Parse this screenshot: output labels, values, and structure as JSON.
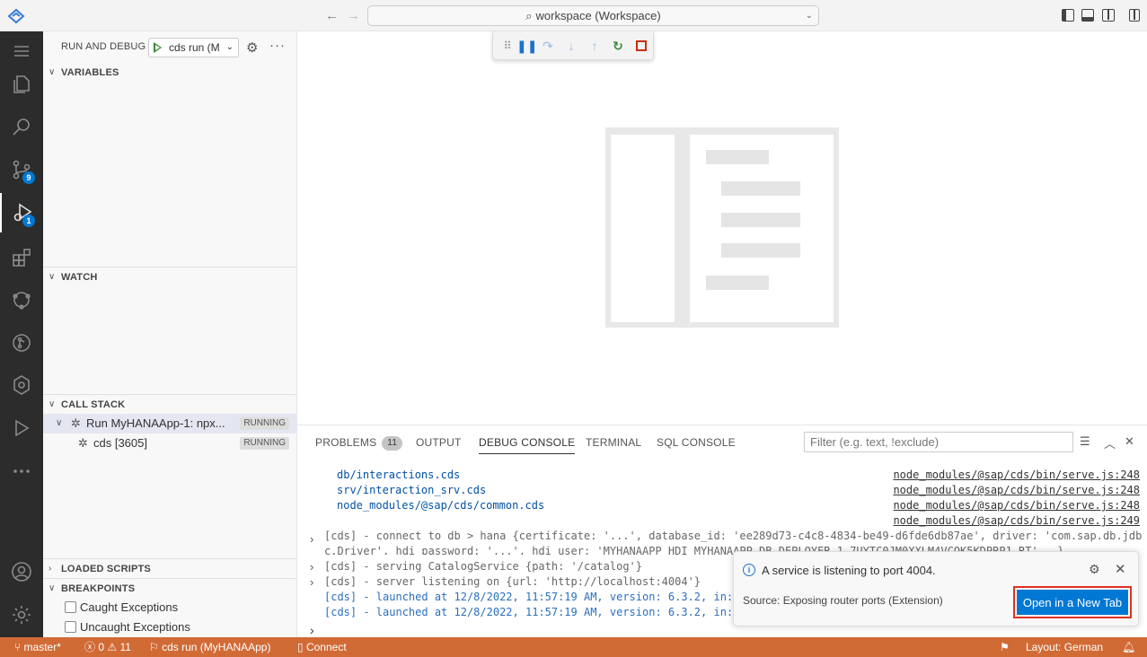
{
  "titlebar": {
    "command_center": "workspace (Workspace)"
  },
  "activity_bar": {
    "source_control_badge": "9",
    "debug_badge": "1"
  },
  "sidebar": {
    "title": "RUN AND DEBUG",
    "config": "cds run (M",
    "sections": {
      "variables": "VARIABLES",
      "watch": "WATCH",
      "call_stack": "CALL STACK",
      "loaded_scripts": "LOADED SCRIPTS",
      "breakpoints": "BREAKPOINTS"
    },
    "call_stack": [
      {
        "label": "Run MyHANAApp-1: npx...",
        "state": "RUNNING"
      },
      {
        "label": "cds [3605]",
        "state": "RUNNING"
      }
    ],
    "breakpoints": [
      {
        "label": "Caught Exceptions",
        "checked": false
      },
      {
        "label": "Uncaught Exceptions",
        "checked": false
      }
    ]
  },
  "panel": {
    "tabs": {
      "problems": "PROBLEMS",
      "problems_count": "11",
      "output": "OUTPUT",
      "debug_console": "DEBUG CONSOLE",
      "terminal": "TERMINAL",
      "sql_console": "SQL CONSOLE"
    },
    "filter_placeholder": "Filter (e.g. text, !exclude)",
    "console": {
      "files": [
        {
          "text": "db/interactions.cds",
          "src": "node_modules/@sap/cds/bin/serve.js:248"
        },
        {
          "text": "srv/interaction_srv.cds",
          "src": "node_modules/@sap/cds/bin/serve.js:248"
        },
        {
          "text": "node_modules/@sap/cds/common.cds",
          "src": "node_modules/@sap/cds/bin/serve.js:248"
        },
        {
          "text": "",
          "src": "node_modules/@sap/cds/bin/serve.js:249"
        }
      ],
      "connect_1": "[cds] - connect to db > hana {certificate: '...', database_id: 'ee289d73-c4c8-4834-be49-d6fde6db87ae', driver: 'com.sap.db.jdb",
      "connect_2": "c.Driver', hdi_password: '...', hdi_user: 'MYHANAAPP_HDI_MYHANAAPP_DB_DEPLOYER_1_7UYTC0JM0XXLM4VCQK5KDPRP1_RT', …}",
      "serving": "[cds] - serving CatalogService {path: '/catalog'}",
      "listening": "[cds] - server listening on {url: 'http://localhost:4004'}",
      "launched_1": "[cds] - launched at 12/8/2022, 11:57:19 AM, version: 6.3.2, in:",
      "launched_2": "[cds] - launched at 12/8/2022, 11:57:19 AM, version: 6.3.2, in:"
    }
  },
  "notification": {
    "message": "A service is listening to port 4004.",
    "source": "Source: Exposing router ports (Extension)",
    "button": "Open in a New Tab"
  },
  "statusbar": {
    "branch": "master*",
    "errors": "0",
    "warnings": "11",
    "debug_config": "cds run (MyHANAApp)",
    "connect": "Connect",
    "layout": "Layout: German"
  },
  "colors": {
    "statusbar": "#d16b36",
    "accent": "#0078d4",
    "highlight_border": "#e0301e"
  }
}
